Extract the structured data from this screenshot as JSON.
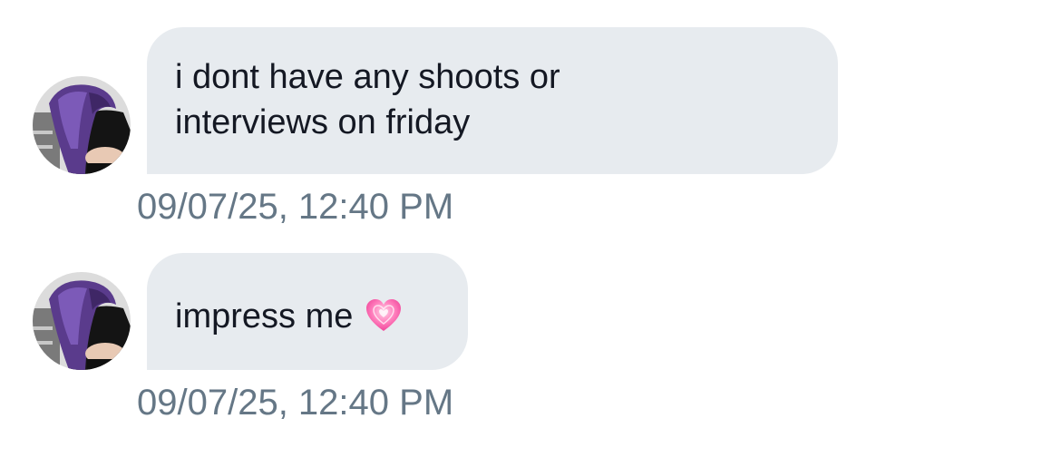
{
  "conversation": {
    "messages": [
      {
        "avatar_icon": "profile-photo-purple-hair",
        "text_lines": [
          "i dont have any shoots or",
          "interviews on friday"
        ],
        "timestamp": "09/07/25, 12:40 PM"
      },
      {
        "avatar_icon": "profile-photo-purple-hair",
        "text": "impress me",
        "emoji": "💗",
        "timestamp": "09/07/25, 12:40 PM"
      }
    ]
  },
  "colors": {
    "bubble_background": "#e7ebef",
    "message_text": "#141823",
    "timestamp_text": "#657786",
    "page_background": "#ffffff"
  }
}
